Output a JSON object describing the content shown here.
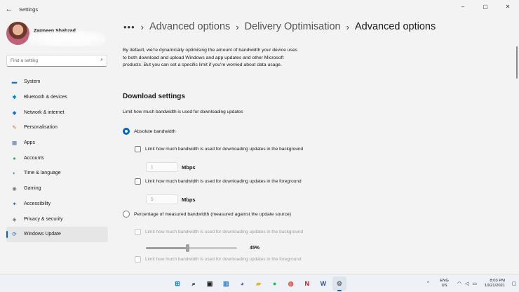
{
  "window": {
    "title": "Settings",
    "back_icon": "arrow-left",
    "controls": {
      "minimize": "–",
      "maximize": "▢",
      "close": "✕"
    }
  },
  "profile": {
    "name": "Zarmeen Shahzad"
  },
  "search": {
    "placeholder": "Find a setting",
    "icon": "⌕"
  },
  "nav": {
    "items": [
      {
        "label": "System",
        "icon": "▬",
        "color": "#0078d4"
      },
      {
        "label": "Bluetooth & devices",
        "icon": "✱",
        "color": "#0078d4"
      },
      {
        "label": "Network & internet",
        "icon": "◆",
        "color": "#1a6fd0"
      },
      {
        "label": "Personalisation",
        "icon": "✎",
        "color": "#d86a2a"
      },
      {
        "label": "Apps",
        "icon": "▦",
        "color": "#4a6fa5"
      },
      {
        "label": "Accounts",
        "icon": "●",
        "color": "#2fa86b"
      },
      {
        "label": "Time & language",
        "icon": "◐",
        "color": "#1f8fd6"
      },
      {
        "label": "Gaming",
        "icon": "◉",
        "color": "#7a7a7a"
      },
      {
        "label": "Accessibility",
        "icon": "✦",
        "color": "#1f6fc0"
      },
      {
        "label": "Privacy & security",
        "icon": "◈",
        "color": "#6b6b6b"
      },
      {
        "label": "Windows Update",
        "icon": "⟳",
        "color": "#0067c0"
      }
    ],
    "active": "Windows Update"
  },
  "breadcrumb": {
    "more": "•••",
    "separator": "›",
    "items": [
      "Advanced options",
      "Delivery Optimisation"
    ],
    "current": "Advanced options"
  },
  "description": "By default, we're dynamically optimising the amount of bandwidth your device uses to both download and upload Windows and app updates and other Microsoft products. But you can set a specific limit if you're worried about data usage.",
  "download": {
    "title": "Download settings",
    "subtitle": "Limit how much bandwidth is used for downloading updates",
    "absolute": {
      "label": "Absolute bandwidth",
      "selected": true,
      "background_label": "Limit how much bandwidth is used for downloading updates in the background",
      "background_value": "1",
      "background_unit": "Mbps",
      "foreground_label": "Limit how much bandwidth is used for downloading updates in the foreground",
      "foreground_value": "5",
      "foreground_unit": "Mbps"
    },
    "percentage": {
      "label": "Percentage of measured bandwidth (measured against the update source)",
      "selected": false,
      "background_label": "Limit how much bandwidth is used for downloading updates in the background",
      "background_percent": 45,
      "background_value_text": "45%",
      "foreground_label": "Limit how much bandwidth is used for downloading updates in the foreground"
    }
  },
  "taskbar": {
    "apps": [
      {
        "name": "start",
        "glyph": "⊞",
        "color": "#0078d4"
      },
      {
        "name": "search",
        "glyph": "⌕",
        "color": "#222222"
      },
      {
        "name": "task-view",
        "glyph": "▣",
        "color": "#222222"
      },
      {
        "name": "widgets",
        "glyph": "▥",
        "color": "#1f7bd6"
      },
      {
        "name": "teams-chat",
        "glyph": "◕",
        "color": "#6264a7"
      },
      {
        "name": "file-explorer",
        "glyph": "▰",
        "color": "#e8b02b"
      },
      {
        "name": "spotify",
        "glyph": "●",
        "color": "#1db954"
      },
      {
        "name": "chrome",
        "glyph": "◍",
        "color": "#e04a3a"
      },
      {
        "name": "netflix",
        "glyph": "N",
        "color": "#e50914"
      },
      {
        "name": "word",
        "glyph": "W",
        "color": "#2b579a"
      },
      {
        "name": "settings",
        "glyph": "⚙",
        "color": "#5a6a7a"
      }
    ],
    "active_app": "settings",
    "language": {
      "line1": "ENG",
      "line2": "US"
    },
    "time": "8:03 PM",
    "date": "10/21/2021"
  },
  "colors": {
    "accent": "#0067c0",
    "background": "#f3f3f3"
  }
}
